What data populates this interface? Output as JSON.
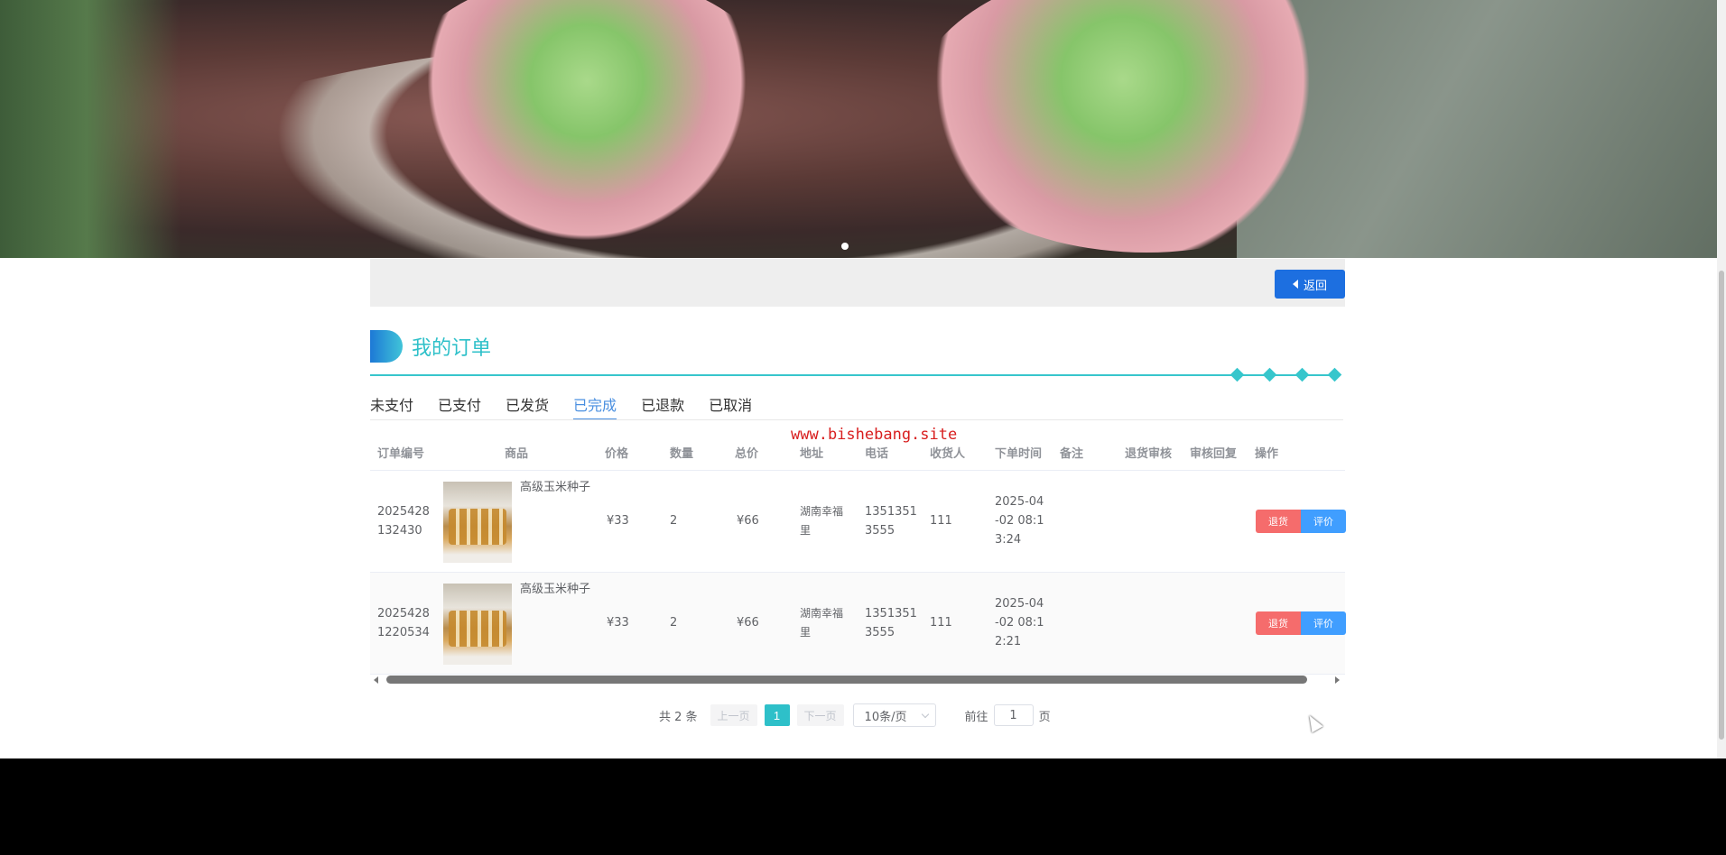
{
  "banner": {
    "image_alt": "succulent plant",
    "carousel_dots": 1
  },
  "topbar": {
    "back_label": "返回"
  },
  "section": {
    "title": "我的订单"
  },
  "tabs": [
    {
      "label": "未支付",
      "active": false
    },
    {
      "label": "已支付",
      "active": false
    },
    {
      "label": "已发货",
      "active": false
    },
    {
      "label": "已完成",
      "active": true
    },
    {
      "label": "已退款",
      "active": false
    },
    {
      "label": "已取消",
      "active": false
    }
  ],
  "watermark": "www.bishebang.site",
  "table": {
    "columns": [
      "订单编号",
      "商品",
      "价格",
      "数量",
      "总价",
      "地址",
      "电话",
      "收货人",
      "下单时间",
      "备注",
      "退货审核",
      "审核回复",
      "操作"
    ],
    "rows": [
      {
        "order_no": "2025428132430",
        "order_no_l1": "2025428",
        "order_no_l2": "132430",
        "product": "高级玉米种子",
        "price": "¥33",
        "qty": "2",
        "total": "¥66",
        "address_l1": "湖南幸福",
        "address_l2": "里",
        "phone_l1": "1351351",
        "phone_l2": "3555",
        "receiver": "111",
        "time_l1": "2025-04",
        "time_l2": "-02 08:1",
        "time_l3": "3:24",
        "return_label": "退货",
        "review_label": "评价"
      },
      {
        "order_no": "20254281220534",
        "order_no_l1": "2025428",
        "order_no_l2": "1220534",
        "product": "高级玉米种子",
        "price": "¥33",
        "qty": "2",
        "total": "¥66",
        "address_l1": "湖南幸福",
        "address_l2": "里",
        "phone_l1": "1351351",
        "phone_l2": "3555",
        "receiver": "111",
        "time_l1": "2025-04",
        "time_l2": "-02 08:1",
        "time_l3": "2:21",
        "return_label": "退货",
        "review_label": "评价"
      }
    ]
  },
  "pagination": {
    "total_text": "共 2 条",
    "prev_label": "上一页",
    "current_page": "1",
    "next_label": "下一页",
    "page_size": "10条/页",
    "goto_label": "前往",
    "goto_value": "1",
    "page_suffix": "页"
  },
  "colors": {
    "accent": "#2ec0c9",
    "primary": "#1d6fe0",
    "danger": "#f56c6c",
    "info": "#409eff"
  }
}
